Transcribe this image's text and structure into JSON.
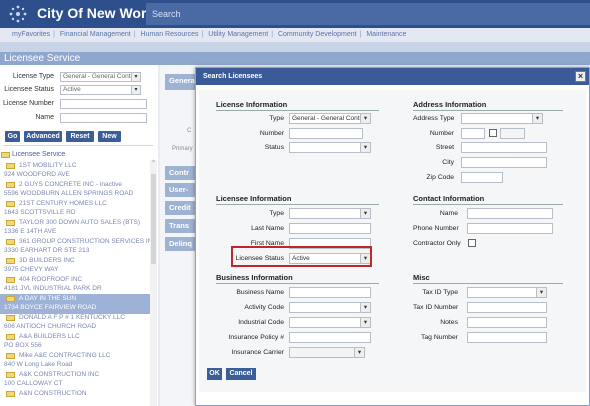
{
  "header": {
    "title": "City Of New World",
    "search_placeholder": "Search"
  },
  "menu": [
    "myFavorites",
    "Financial Management",
    "Human Resources",
    "Utility Management",
    "Community Development",
    "Maintenance"
  ],
  "service_title": "Licensee Service",
  "left": {
    "license_type_label": "License Type",
    "license_type_value": "General - General Contr",
    "licensee_status_label": "Licensee Status",
    "licensee_status_value": "Active",
    "license_number_label": "License Number",
    "name_label": "Name",
    "buttons": {
      "go": "Go",
      "advanced": "Advanced",
      "reset": "Reset",
      "new": "New"
    },
    "tree_root": "Licensee Service",
    "items": [
      {
        "name": "1ST MOBILITY LLC",
        "addr": "924 WOODFORD AVE"
      },
      {
        "name": "2 GUYS CONCRETE INC - inactive",
        "addr": "5596 WOODBURN ALLEN SPRINGS ROAD"
      },
      {
        "name": "21ST CENTURY HOMES LLC",
        "addr": "1643 SCOTTSVILLE RD"
      },
      {
        "name": "TAYLOR 300 DOWN AUTO SALES (BTS)",
        "addr": "1336 E 14TH AVE"
      },
      {
        "name": "361 GROUP CONSTRUCTION SERVICES INC",
        "addr": "3330 EARHART DR STE 213"
      },
      {
        "name": "3D BUILDERS INC",
        "addr": "3975 CHEVY WAY"
      },
      {
        "name": "404 ROOFROOF INC",
        "addr": "4181 JVL INDUSTRIAL PARK DR"
      },
      {
        "name": "A DAY IN THE SUN",
        "addr": "1734 BOYCE FAIRVIEW ROAD"
      },
      {
        "name": "DONALD A F P # 1 KENTUCKY LLC",
        "addr": "606 ANTIOCH CHURCH ROAD"
      },
      {
        "name": "A&A BUILDERS LLC",
        "addr": "PO BOX 556"
      },
      {
        "name": "Mike A&E CONTRACTING LLC",
        "addr": "840 W Long Lake Road"
      },
      {
        "name": "A&K CONSTRUCTION INC",
        "addr": "100 CALLOWAY CT"
      },
      {
        "name": "A&N CONSTRUCTION",
        "addr": ""
      }
    ]
  },
  "bg": {
    "tabs": [
      "General",
      "Contr",
      "User-",
      "Credit",
      "Trans",
      "Delinq"
    ],
    "primary_label": "Primary",
    "c_label": "C"
  },
  "modal": {
    "title": "Search Licensees",
    "license_info": {
      "heading": "License Information",
      "type_label": "Type",
      "type_value": "General - General Contr",
      "number_label": "Number",
      "status_label": "Status"
    },
    "address_info": {
      "heading": "Address Information",
      "address_type_label": "Address Type",
      "number_label": "Number",
      "street_label": "Street",
      "city_label": "City",
      "zip_label": "Zip Code"
    },
    "licensee_info": {
      "heading": "Licensee Information",
      "type_label": "Type",
      "last_name_label": "Last Name",
      "first_name_label": "First Name",
      "status_label": "Licensee Status",
      "status_value": "Active"
    },
    "contact_info": {
      "heading": "Contact Information",
      "name_label": "Name",
      "phone_label": "Phone Number",
      "contractor_only_label": "Contractor Only"
    },
    "business_info": {
      "heading": "Business Information",
      "business_name_label": "Business Name",
      "activity_code_label": "Activity Code",
      "industrial_code_label": "Industrial Code",
      "insurance_policy_label": "Insurance Policy #",
      "insurance_carrier_label": "Insurance Carrier"
    },
    "misc": {
      "heading": "Misc",
      "tax_id_type_label": "Tax ID Type",
      "tax_id_number_label": "Tax ID Number",
      "notes_label": "Notes",
      "tag_number_label": "Tag Number"
    },
    "ok": "OK",
    "cancel": "Cancel"
  },
  "colors": {
    "header": "#2d4f8c",
    "button": "#3b5d98",
    "highlight": "#c0272d"
  }
}
